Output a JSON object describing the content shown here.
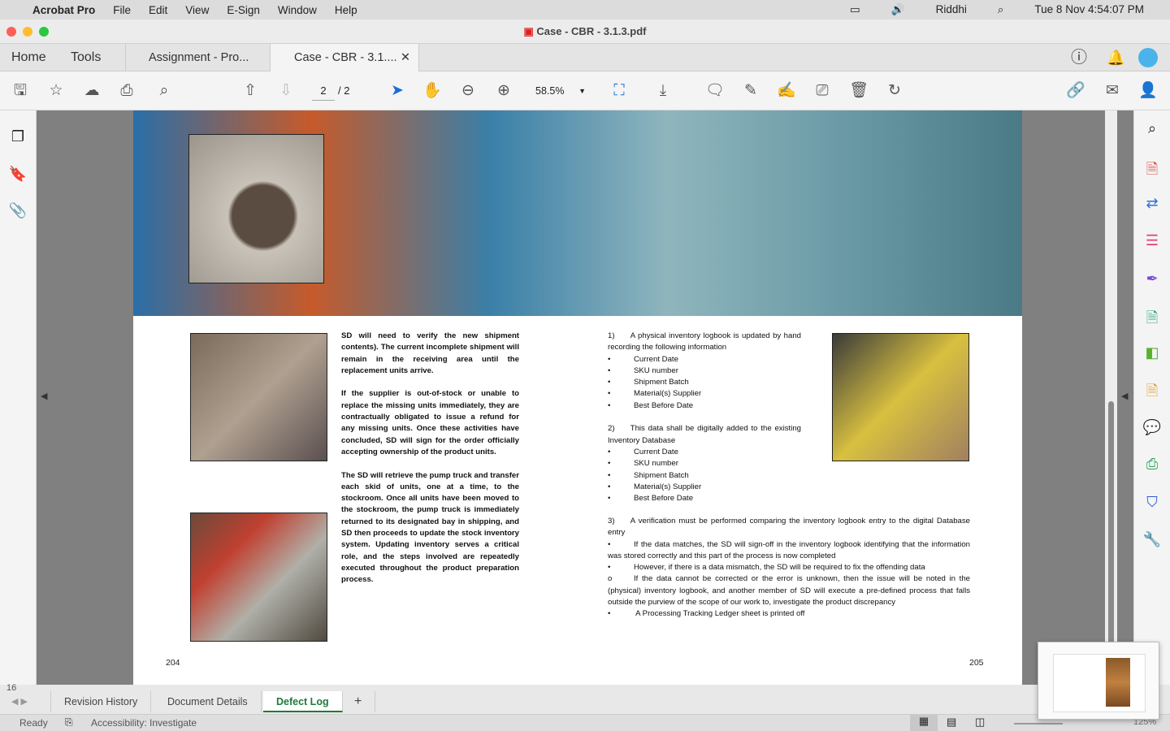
{
  "menubar": {
    "app": "Acrobat Pro",
    "items": [
      "File",
      "Edit",
      "View",
      "E-Sign",
      "Window",
      "Help"
    ],
    "user": "Riddhi",
    "clock": "Tue 8 Nov  4:54:07 PM"
  },
  "window": {
    "title": "Case - CBR - 3.1.3.pdf"
  },
  "tabs": {
    "home": "Home",
    "tools": "Tools",
    "docs": [
      "Assignment - Pro...",
      "Case - CBR - 3.1...."
    ]
  },
  "toolbar": {
    "page_current": "2",
    "page_total": "/ 2",
    "zoom": "58.5%"
  },
  "document": {
    "left_col": [
      "SD will need to verify the new shipment contents). The current incomplete shipment will remain in the receiving area until the replacement units arrive.",
      "If the supplier is out-of-stock or unable to replace the missing units immediately, they are contractually obligated to issue a refund for any missing units. Once these activities have concluded, SD will sign for the order officially accepting ownership of the product units.",
      "The SD will retrieve the pump truck and transfer each skid of units, one at a time, to the stockroom. Once all units have been moved to the stockroom, the pump truck is immediately returned to its designated bay in shipping, and SD then proceeds to update the stock inventory system. Updating inventory serves a critical role, and the steps involved are repeatedly executed throughout the product preparation process."
    ],
    "step1": "1)  A physical inventory logbook is updated by hand recording the following information",
    "step2": "2)  This data shall be digitally added to the existing Inventory Database",
    "fields": [
      "Current Date",
      "SKU number",
      "Shipment Batch",
      "Material(s) Supplier",
      "Best Before Date"
    ],
    "step3": "3)  A verification must be performed comparing the inventory logbook entry to the digital Database entry",
    "step3_items": [
      {
        "mark": "•",
        "text": "If the data matches, the SD will sign-off in the inventory logbook identifying that the information was stored correctly and this part of the process is now completed"
      },
      {
        "mark": "•",
        "text": "However, if there is a data mismatch, the SD will be required to fix the offending data"
      },
      {
        "mark": "o",
        "text": "If the data cannot be corrected or the error is unknown, then the issue will be noted in the (physical) inventory logbook, and another member of SD will execute a pre-defined process that falls outside the purview of the scope of our work to, investigate the product discrepancy"
      },
      {
        "mark": "•",
        "text": " A Processing Tracking Ledger sheet is printed off"
      }
    ],
    "page_left": "204",
    "page_right": "205"
  },
  "excel": {
    "row": "16",
    "sheets": [
      "Revision History",
      "Document Details",
      "Defect Log"
    ],
    "active_sheet": "Defect Log",
    "status": "Ready",
    "accessibility": "Accessibility: Investigate",
    "zoom": "125%",
    "accent": "#1e7b3c"
  }
}
